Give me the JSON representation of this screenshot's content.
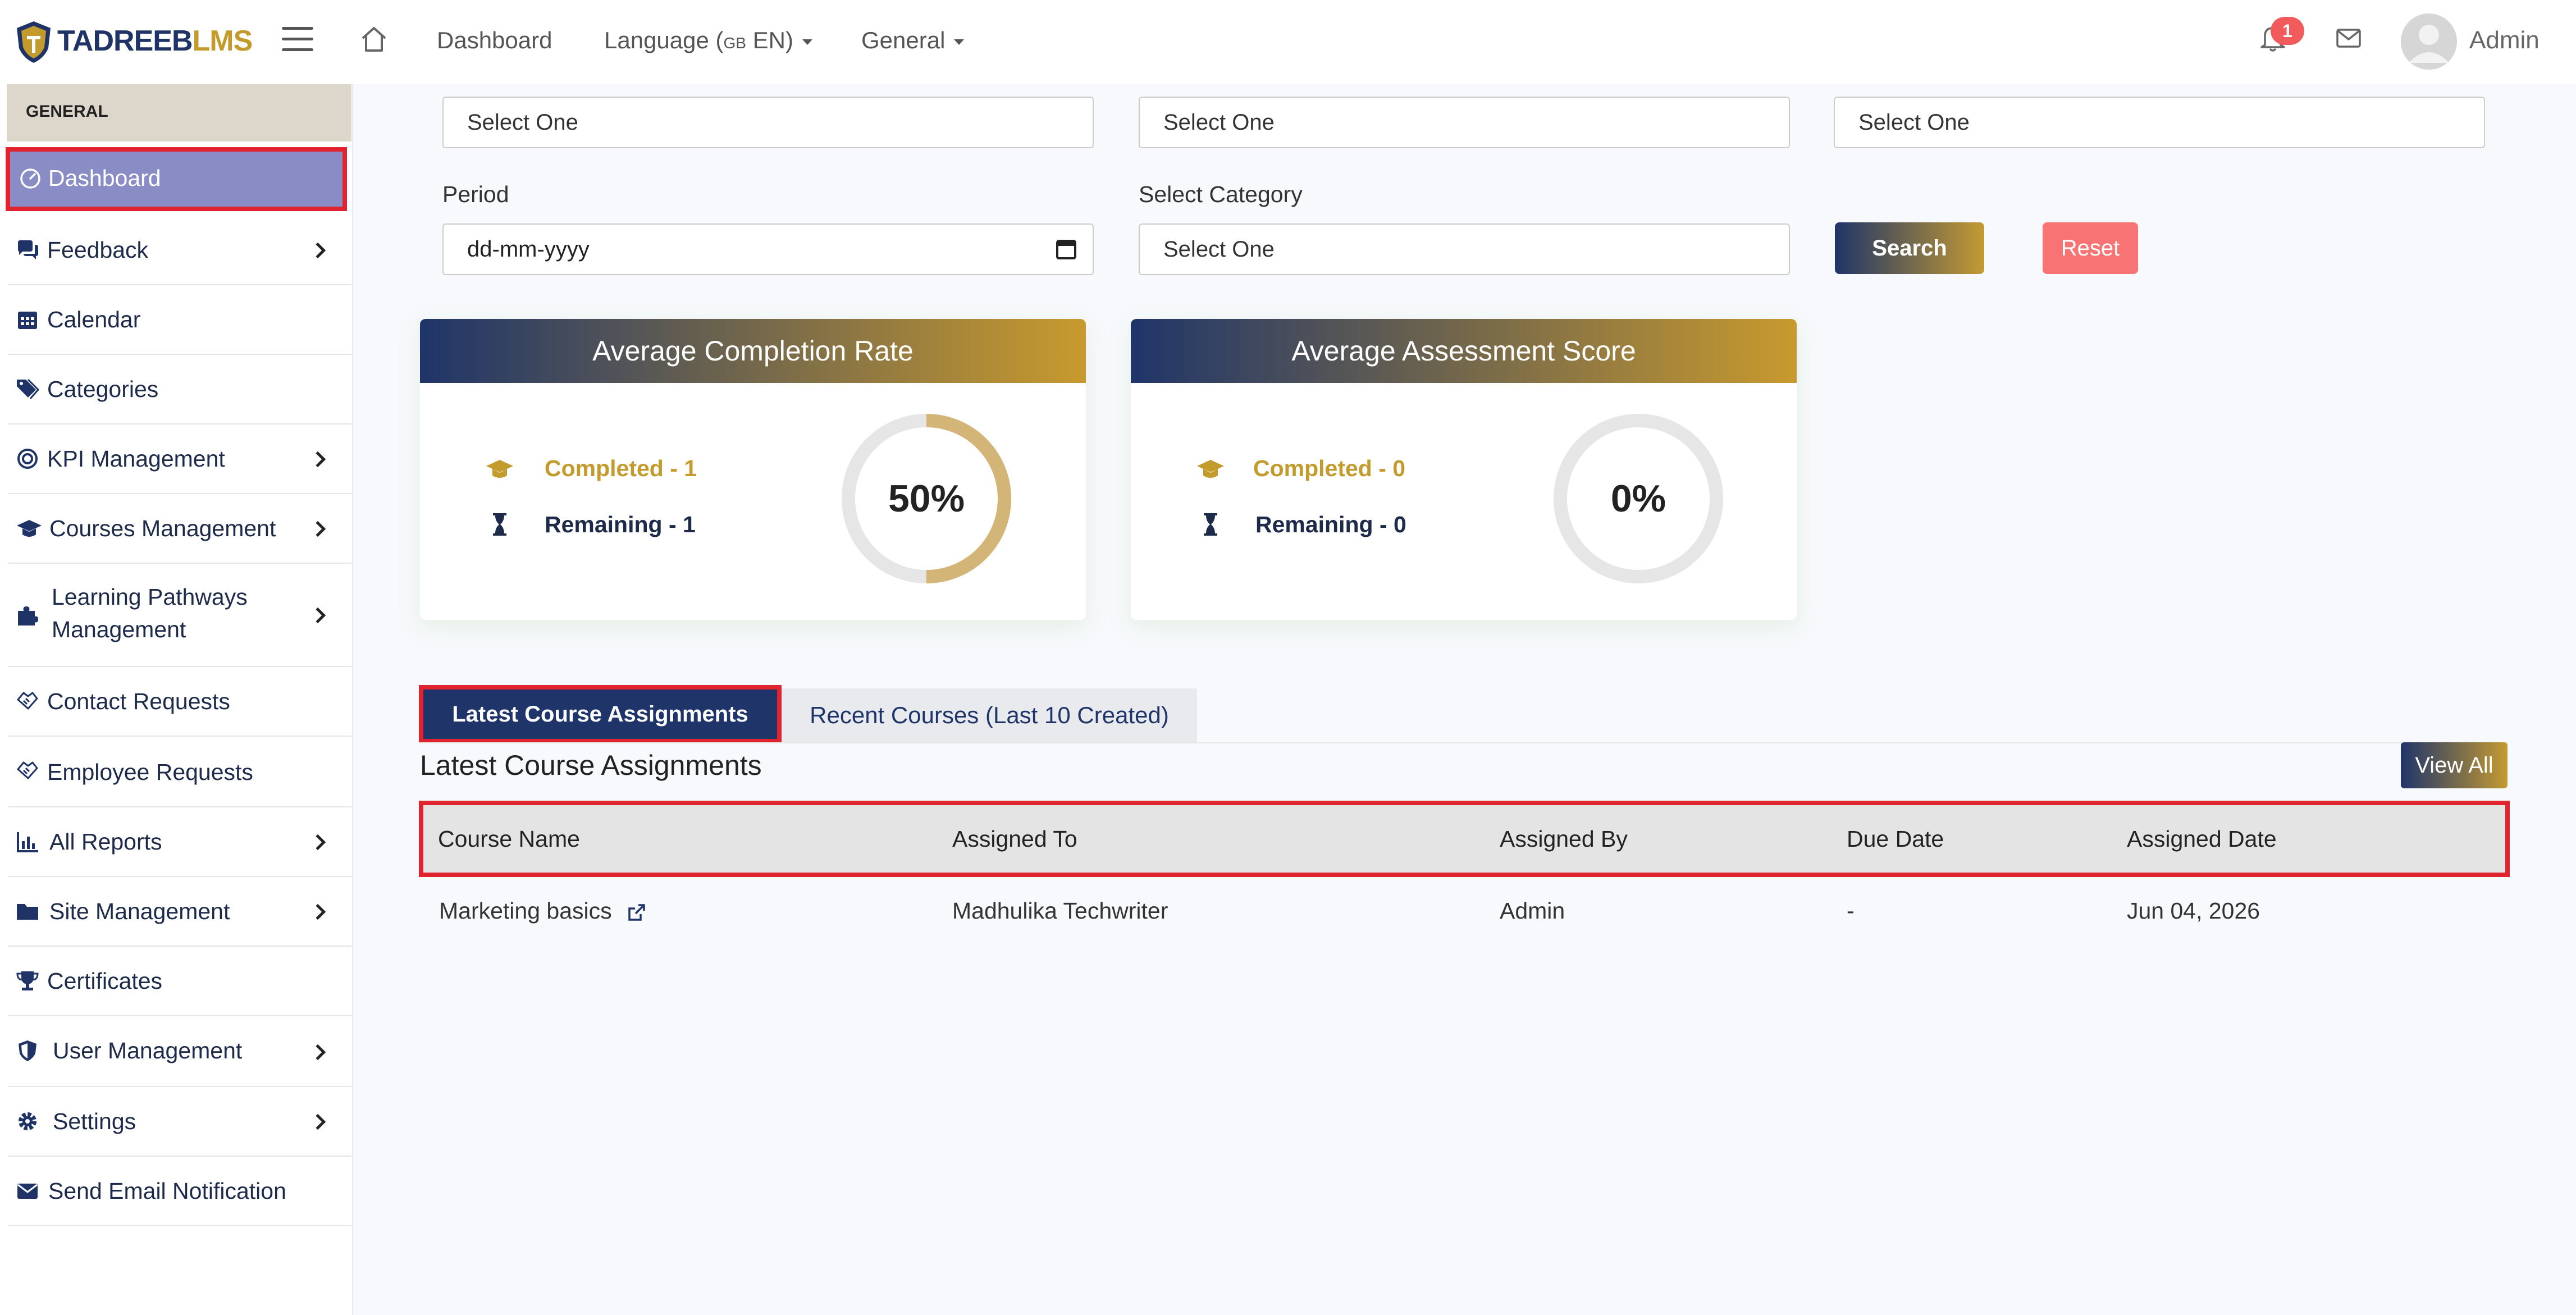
{
  "brand": {
    "part1": "TADREEB",
    "part2": "LMS"
  },
  "topnav": {
    "dashboard": "Dashboard",
    "language_label": "Language (",
    "language_flag": "GB",
    "language_code": " EN)",
    "general": "General",
    "notification_count": "1",
    "user_name": "Admin"
  },
  "sidebar": {
    "section": "GENERAL",
    "items": [
      {
        "label": "Dashboard",
        "icon": "gauge-icon"
      },
      {
        "label": "Feedback",
        "icon": "comments-icon"
      },
      {
        "label": "Calendar",
        "icon": "calendar-icon"
      },
      {
        "label": "Categories",
        "icon": "tags-icon"
      },
      {
        "label": "KPI Management",
        "icon": "target-icon"
      },
      {
        "label": "Courses Management",
        "icon": "graduation-cap-icon"
      },
      {
        "label": "Learning Pathways",
        "label2": "Management",
        "icon": "puzzle-icon"
      },
      {
        "label": "Contact Requests",
        "icon": "handshake-icon"
      },
      {
        "label": "Employee Requests",
        "icon": "handshake-icon"
      },
      {
        "label": "All Reports",
        "icon": "bar-chart-icon"
      },
      {
        "label": "Site Management",
        "icon": "folder-icon"
      },
      {
        "label": "Certificates",
        "icon": "trophy-icon"
      },
      {
        "label": "User Management",
        "icon": "shield-icon"
      },
      {
        "label": "Settings",
        "icon": "gear-icon"
      },
      {
        "label": "Send Email Notification",
        "icon": "envelope-icon"
      }
    ]
  },
  "filters": {
    "select1": "Select One",
    "select2": "Select One",
    "select3": "Select One",
    "period_label": "Period",
    "period_placeholder": "dd-mm-yyyy",
    "category_label": "Select Category",
    "category_value": "Select One",
    "search_label": "Search",
    "reset_label": "Reset"
  },
  "cards": {
    "completion": {
      "title": "Average Completion Rate",
      "completed": "Completed - 1",
      "remaining": "Remaining - 1",
      "percent_label": "50%",
      "percent": 50
    },
    "assessment": {
      "title": "Average Assessment Score",
      "completed": "Completed - 0",
      "remaining": "Remaining - 0",
      "percent_label": "0%",
      "percent": 0
    }
  },
  "tabs": {
    "active": "Latest Course Assignments",
    "other": "Recent Courses (Last 10 Created)"
  },
  "section": {
    "title": "Latest Course Assignments",
    "view_all": "View All"
  },
  "table": {
    "headers": [
      "Course Name",
      "Assigned To",
      "Assigned By",
      "Due Date",
      "Assigned Date"
    ],
    "rows": [
      [
        "Marketing basics",
        "Madhulika Techwriter",
        "Admin",
        "-",
        "Jun 04, 2026"
      ]
    ]
  },
  "colors": {
    "primary_navy": "#1f3569",
    "accent_gold": "#c89a2e",
    "active_sidebar": "#8a8cc6",
    "highlight_red": "#e0232f",
    "reset_red": "#f87373"
  }
}
